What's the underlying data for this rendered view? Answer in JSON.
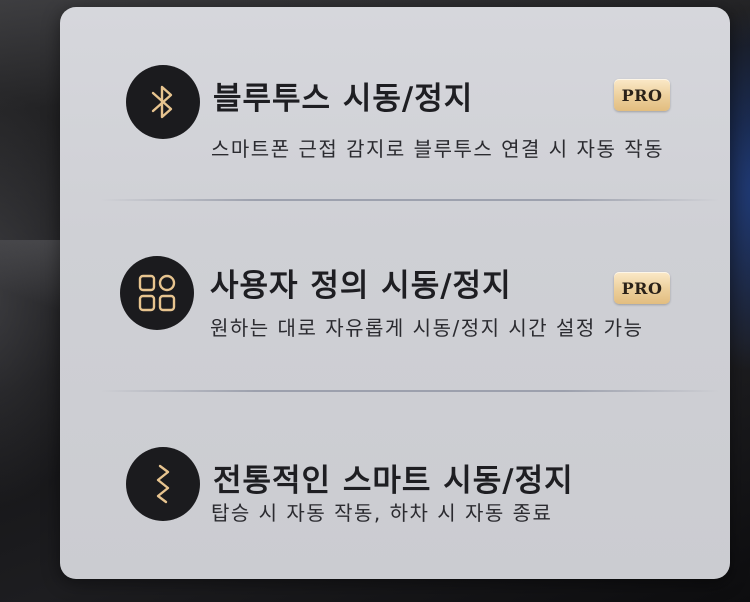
{
  "features": [
    {
      "title": "블루투스 시동/정지",
      "subtitle": "스마트폰 근접 감지로 블루투스 연결 시 자동 작동",
      "badge": "PRO",
      "icon": "bluetooth-icon"
    },
    {
      "title": "사용자 정의 시동/정지",
      "subtitle": "원하는 대로 자유롭게 시동/정지 시간 설정 가능",
      "badge": "PRO",
      "icon": "grid-icon"
    },
    {
      "title": "전통적인 스마트 시동/정지",
      "subtitle": "탑승 시 자동 작동, 하차 시 자동 종료",
      "icon": "zigzag-icon"
    }
  ],
  "colors": {
    "icon_accent": "#e7c48f",
    "badge_gold": "#eccf9b",
    "panel_bg": "#d2d3d8",
    "icon_bg": "#1b1b1e"
  }
}
